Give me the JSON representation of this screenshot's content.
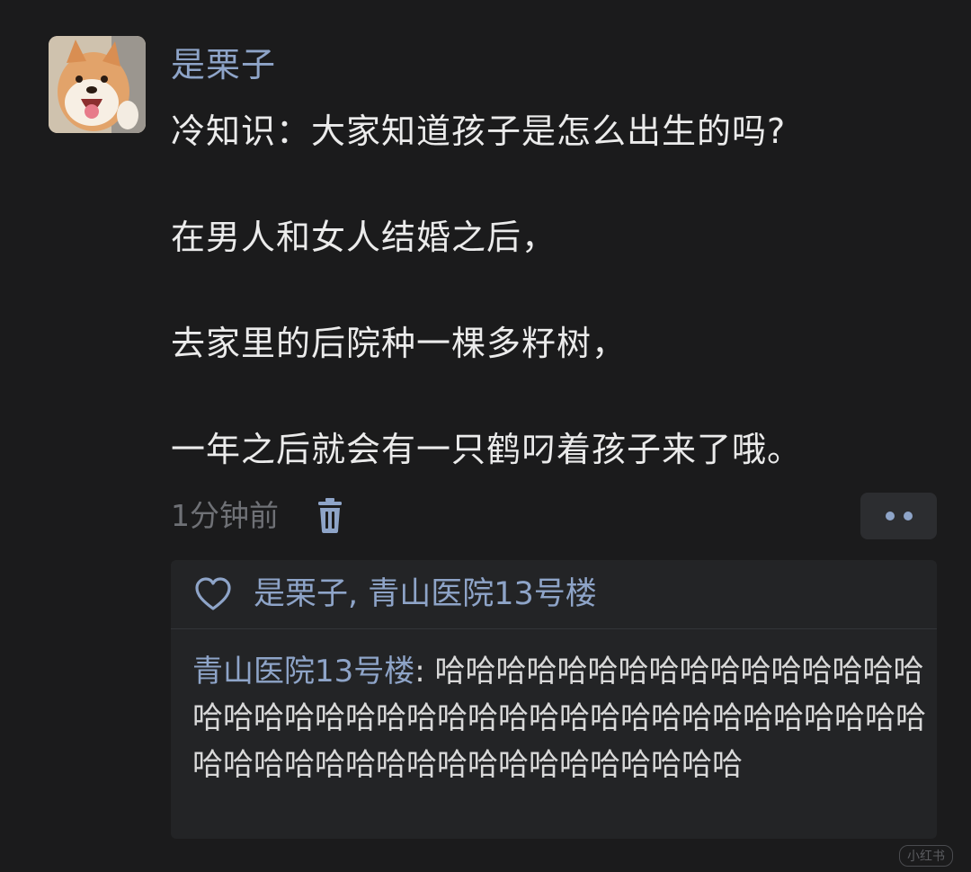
{
  "post": {
    "author": "是栗子",
    "lines": [
      "冷知识：大家知道孩子是怎么出生的吗?",
      "在男人和女人结婚之后，",
      "去家里的后院种一棵多籽树，",
      "一年之后就会有一只鹤叼着孩子来了哦。"
    ],
    "time": "1分钟前",
    "delete_icon": "trash-icon",
    "more_icon": "more-dots-icon"
  },
  "likes": {
    "icon": "heart-icon",
    "names": "是栗子, 青山医院13号楼"
  },
  "comments": [
    {
      "author": "青山医院13号楼",
      "separator": ": ",
      "text": "哈哈哈哈哈哈哈哈哈哈哈哈哈哈哈哈哈哈哈哈哈哈哈哈哈哈哈哈哈哈哈哈哈哈哈哈哈哈哈哈哈哈哈哈哈哈哈哈哈哈哈哈哈哈哈哈哈哈"
    }
  ],
  "watermark": "小红书",
  "colors": {
    "background": "#1b1b1c",
    "link": "#8ea4c8",
    "panel": "#232426",
    "meta": "#6f7176"
  }
}
